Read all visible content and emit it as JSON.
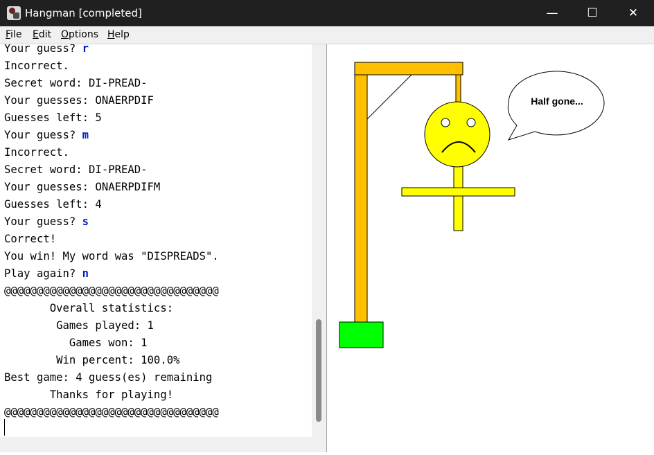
{
  "window": {
    "title": "Hangman [completed]",
    "icon": "hangman-app-icon",
    "controls": {
      "minimize": "—",
      "maximize": "☐",
      "close": "✕"
    }
  },
  "menu": {
    "file": {
      "key": "F",
      "rest": "ile"
    },
    "edit": {
      "key": "E",
      "rest": "dit"
    },
    "options": {
      "key": "O",
      "rest": "ptions"
    },
    "help": {
      "key": "H",
      "rest": "elp"
    }
  },
  "console": {
    "lines": [
      {
        "text": "Your guess? ",
        "input": "r"
      },
      {
        "text": "Incorrect.",
        "input": ""
      },
      {
        "text": "Secret word: DI-PREAD-",
        "input": ""
      },
      {
        "text": "Your guesses: ONAERPDIF",
        "input": ""
      },
      {
        "text": "Guesses left: 5",
        "input": ""
      },
      {
        "text": "Your guess? ",
        "input": "m"
      },
      {
        "text": "Incorrect.",
        "input": ""
      },
      {
        "text": "Secret word: DI-PREAD-",
        "input": ""
      },
      {
        "text": "Your guesses: ONAERPDIFM",
        "input": ""
      },
      {
        "text": "Guesses left: 4",
        "input": ""
      },
      {
        "text": "Your guess? ",
        "input": "s"
      },
      {
        "text": "Correct!",
        "input": ""
      },
      {
        "text": "You win! My word was \"DISPREADS\".",
        "input": ""
      },
      {
        "text": "Play again? ",
        "input": "n"
      },
      {
        "text": "@@@@@@@@@@@@@@@@@@@@@@@@@@@@@@@@@",
        "input": ""
      },
      {
        "text": "       Overall statistics:",
        "input": ""
      },
      {
        "text": "        Games played: 1",
        "input": ""
      },
      {
        "text": "          Games won: 1",
        "input": ""
      },
      {
        "text": "        Win percent: 100.0%",
        "input": ""
      },
      {
        "text": "Best game: 4 guess(es) remaining",
        "input": ""
      },
      {
        "text": "       Thanks for playing!",
        "input": ""
      },
      {
        "text": "@@@@@@@@@@@@@@@@@@@@@@@@@@@@@@@@@",
        "input": ""
      }
    ]
  },
  "drawing": {
    "speech": "Half gone...",
    "colors": {
      "gallows": "#ffc000",
      "figure": "#ffff00",
      "base": "#00ff00",
      "outline": "#000000"
    }
  }
}
